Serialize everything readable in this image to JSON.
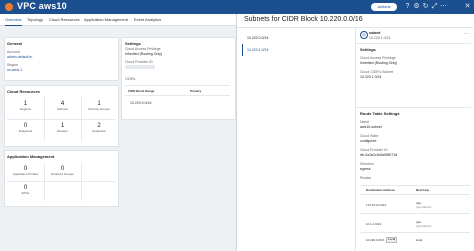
{
  "header": {
    "title": "VPC aws10",
    "badge": "Actions",
    "colors": {
      "bar": "#1b4f8f",
      "logo": "#ee7a2d"
    }
  },
  "tabs": [
    "Overview",
    "Topology",
    "Cloud Resources",
    "Application Management",
    "Event Analytics"
  ],
  "general": {
    "heading": "General",
    "account_label": "Account",
    "account_value": "admin-default-tn",
    "region_label": "Region",
    "region_value": "us-west-1"
  },
  "settings": {
    "heading": "Settings",
    "access_label": "Cloud Access Privilege",
    "access_value": "Inherited (Routing Only)",
    "provider_label": "Cloud Provider ID",
    "provider_value": "vpc-0a1b2c3d",
    "cidrs_label": "CIDRs",
    "col_block": "CIDR Block Range",
    "col_primary": "Primary",
    "cidr_row": "10.220.0.0/16"
  },
  "cloud_resources": {
    "heading": "Cloud Resources",
    "items": [
      {
        "num": "1",
        "cap": "Regions"
      },
      {
        "num": "4",
        "cap": "Subnets"
      },
      {
        "num": "1",
        "cap": "Security Groups"
      },
      {
        "num": "0",
        "cap": "Endpoints"
      },
      {
        "num": "1",
        "cap": "Routers"
      },
      {
        "num": "2",
        "cap": "Endpoints"
      }
    ]
  },
  "app_mgmt": {
    "heading": "Application Management",
    "items": [
      {
        "num": "0",
        "cap": "Application Profiles"
      },
      {
        "num": "0",
        "cap": "Endpoint Groups"
      },
      {
        "num": "0",
        "cap": "EPGs"
      }
    ]
  },
  "drawer": {
    "title": "Subnets for CIDR Block 10.220.0.0/16",
    "subnets": [
      "10.220.0.0/24",
      "10.220.1.0/24"
    ],
    "selected_name": "subnet",
    "selected_cidr": "10.220.1.0/24",
    "settings_heading": "Settings",
    "access_label": "Cloud Access Privilege",
    "access_value": "Inherited (Routing Only)",
    "subnet_label": "Cloud CIDR's Subnet",
    "subnet_value": "10.220.1.0/24",
    "route_heading": "Route Table Settings",
    "name_label": "Name",
    "name_value": "aws10-subnet",
    "state_label": "Cloud State",
    "state_value": "configured",
    "pid_label": "Cloud Provider ID",
    "pid_value": "rtb-0a1b2c3d4e5f60718",
    "desc_label": "Direction",
    "desc_value": "egress",
    "routes_label": "Routes",
    "col_dest": "Destination Address",
    "col_next": "Next Hop",
    "routes": [
      {
        "dest": "172.16.10.0/24",
        "next": "tgw-",
        "sub": "tgw-0a1b2c"
      },
      {
        "dest": "10.1.1.0/24",
        "next": "tgw-",
        "sub": "tgw-0a1b2c"
      },
      {
        "dest": "10.220.0.0/16",
        "next": "local",
        "tag": "Local"
      }
    ]
  }
}
